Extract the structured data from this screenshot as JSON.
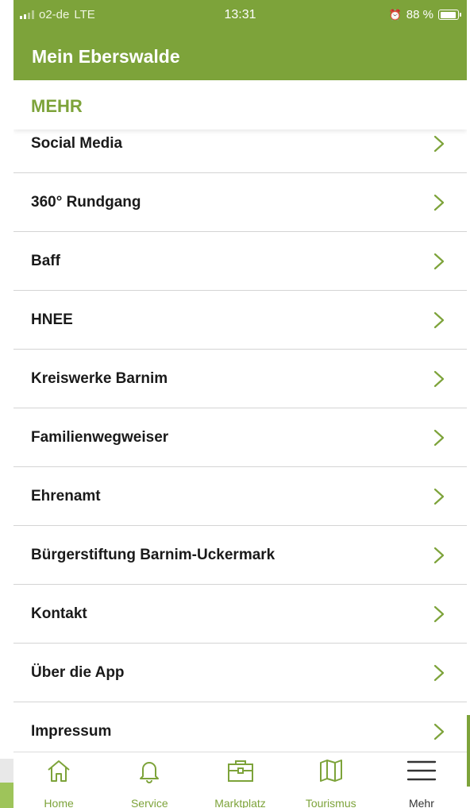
{
  "status_bar": {
    "carrier": "o2-de",
    "network": "LTE",
    "time": "13:31",
    "battery": "88 %",
    "battery_level": 0.88
  },
  "header": {
    "title": "Mein Eberswalde"
  },
  "section": {
    "title": "MEHR"
  },
  "menu": {
    "items": [
      {
        "label": "Social Media"
      },
      {
        "label": "360° Rundgang"
      },
      {
        "label": "Baff"
      },
      {
        "label": "HNEE"
      },
      {
        "label": "Kreiswerke Barnim"
      },
      {
        "label": "Familienwegweiser"
      },
      {
        "label": "Ehrenamt"
      },
      {
        "label": "Bürgerstiftung Barnim-Uckermark"
      },
      {
        "label": "Kontakt"
      },
      {
        "label": "Über die App"
      },
      {
        "label": "Impressum"
      }
    ]
  },
  "tabbar": {
    "tabs": [
      {
        "label": "Home",
        "icon": "home-icon"
      },
      {
        "label": "Service",
        "icon": "bell-icon"
      },
      {
        "label": "Marktplatz",
        "icon": "briefcase-icon"
      },
      {
        "label": "Tourismus",
        "icon": "map-icon"
      },
      {
        "label": "Mehr",
        "icon": "menu-icon",
        "active": true
      }
    ]
  },
  "colors": {
    "brand": "#7da33a",
    "text": "#1a1a1a",
    "divider": "#d4d4d4",
    "active_tab": "#333333"
  }
}
